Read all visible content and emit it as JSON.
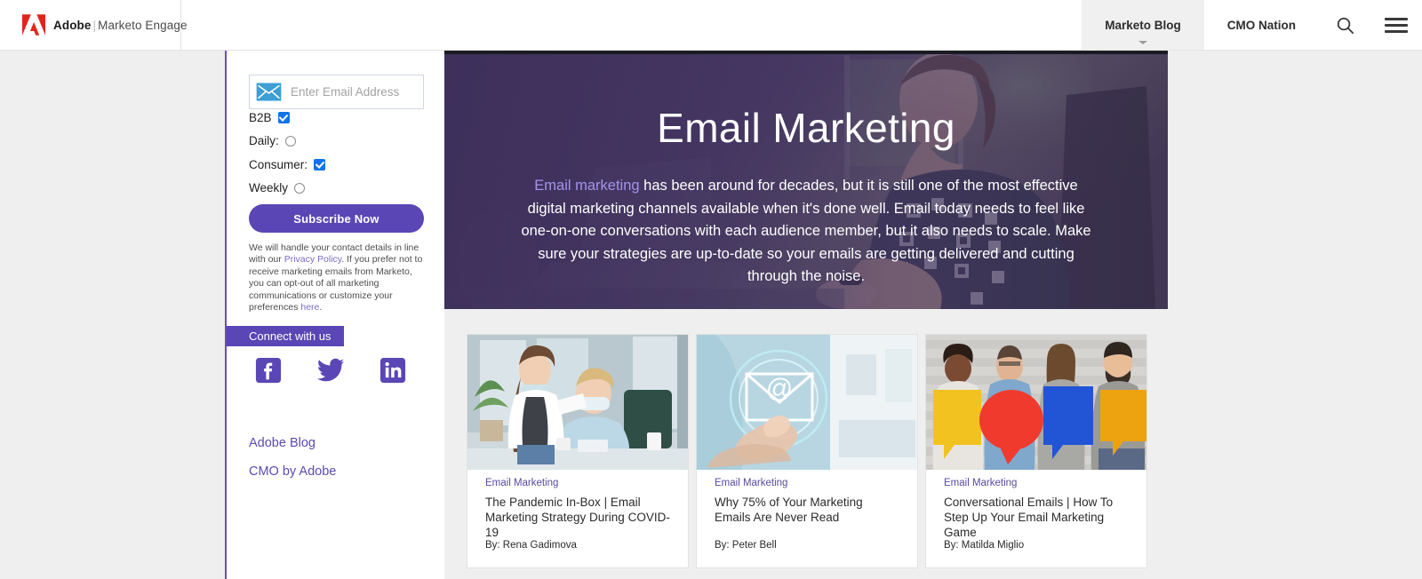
{
  "header": {
    "brand": {
      "adobe": "Adobe",
      "separator": "|",
      "product": "Marketo Engage"
    },
    "nav": [
      {
        "label": "Marketo Blog",
        "active": true,
        "has_dropdown": true
      },
      {
        "label": "CMO Nation",
        "active": false,
        "has_dropdown": false
      }
    ],
    "search_icon": "search-icon",
    "menu_icon": "hamburger-menu-icon"
  },
  "sidebar": {
    "email": {
      "placeholder": "Enter Email Address",
      "value": "",
      "icon": "envelope-icon"
    },
    "options": [
      {
        "label": "B2B",
        "type": "checkbox",
        "checked": true
      },
      {
        "label": "Daily:",
        "type": "radio",
        "checked": false
      },
      {
        "label": "Consumer:",
        "type": "checkbox",
        "checked": true
      },
      {
        "label": "Weekly",
        "type": "radio",
        "checked": false
      }
    ],
    "subscribe_label": "Subscribe Now",
    "fineprint": {
      "part1": "We will handle your contact details in line with our ",
      "link1": "Privacy Policy",
      "part2": ". If you prefer not to receive marketing emails from Marketo, you can opt-out of all marketing communications or customize your preferences ",
      "link2": "here",
      "part3": "."
    },
    "connect_label": "Connect with us",
    "socials": [
      {
        "name": "facebook-icon",
        "label": "Facebook"
      },
      {
        "name": "twitter-icon",
        "label": "Twitter"
      },
      {
        "name": "linkedin-icon",
        "label": "LinkedIn"
      }
    ],
    "links": [
      {
        "label": "Adobe Blog"
      },
      {
        "label": "CMO by Adobe"
      }
    ]
  },
  "hero": {
    "title": "Email Marketing",
    "copy_link": "Email marketing",
    "copy_rest": " has been around for decades, but it is still one of the most effective digital marketing channels available when it's done well. Email today needs to feel like one-on-one conversations with each audience member, but it also needs to scale. Make sure your strategies are up-to-date so your emails are getting delivered and cutting through the noise."
  },
  "cards": [
    {
      "category": "Email Marketing",
      "title": "The Pandemic In-Box | Email Marketing Strategy During COVID-19",
      "author": "By: Rena Gadimova",
      "image": "two-women-in-masks-at-office-desk"
    },
    {
      "category": "Email Marketing",
      "title": "Why 75% of Your Marketing Emails Are Never Read",
      "author": "By: Peter Bell",
      "image": "hand-touching-email-at-symbol-icon"
    },
    {
      "category": "Email Marketing",
      "title": "Conversational Emails | How To Step Up Your Email Marketing Game",
      "author": "By: Matilda Miglio",
      "image": "four-people-holding-colored-speech-bubbles"
    }
  ],
  "colors": {
    "purple": "#5a46b5",
    "purple_border": "#6a4fb8",
    "link_purple": "#5b4bb0",
    "category_purple": "#5a4a9f",
    "checkbox_blue": "#1473e6",
    "envelope_blue": "#3d9fd4",
    "page_bg": "#efefef",
    "adobe_red": "#e1251b"
  }
}
